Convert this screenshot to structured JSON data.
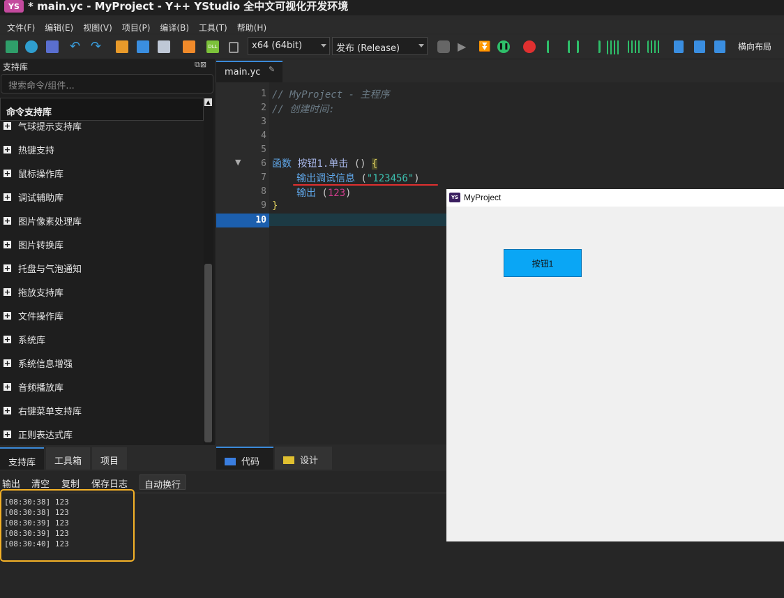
{
  "window": {
    "app_logo": "YS",
    "title": "* main.yc - MyProject - Y++ YStudio 全中文可视化开发环境"
  },
  "menu": [
    "文件(F)",
    "编辑(E)",
    "视图(V)",
    "项目(P)",
    "编译(B)",
    "工具(T)",
    "帮助(H)"
  ],
  "toolbar": {
    "platform": "x64 (64bit)",
    "config": "发布 (Release)",
    "layout_label": "横向布局",
    "icons": [
      "layers-icon",
      "app-icon",
      "save-icon",
      "undo-icon",
      "redo-icon",
      "cut-icon",
      "copy-icon",
      "paste-icon",
      "search-icon",
      "dll-icon",
      "delete-icon",
      "compile-icon",
      "run-icon",
      "step-icon",
      "pause-icon",
      "stop-icon",
      "align-left-icon",
      "align-center-icon",
      "align-right-icon",
      "distribute-h-icon",
      "distribute-v-icon",
      "spread-icon",
      "layout-icon-1",
      "layout-icon-2",
      "layout-icon-3"
    ],
    "accent": "#2fbf6a"
  },
  "left_panel": {
    "title": "支持库",
    "search_placeholder": "搜索命令/组件...",
    "header": "命令支持库",
    "items": [
      "气球提示支持库",
      "热键支持",
      "鼠标操作库",
      "调试辅助库",
      "图片像素处理库",
      "图片转换库",
      "托盘与气泡通知",
      "拖放支持库",
      "文件操作库",
      "系统库",
      "系统信息增强",
      "音频播放库",
      "右键菜单支持库",
      "正则表达式库"
    ],
    "expander": "+",
    "tabs": [
      "支持库",
      "工具箱",
      "项目"
    ]
  },
  "editor": {
    "file_tab": "main.yc",
    "line_numbers": [
      "1",
      "2",
      "3",
      "4",
      "5",
      "6",
      "7",
      "8",
      "9",
      "10"
    ],
    "current_line": "10",
    "code": {
      "l1": "// MyProject - 主程序",
      "l2": "// 创建时间:",
      "l6_kw": "函数",
      "l6_name": "按钮1",
      "l6_dot": ".",
      "l6_event": "单击",
      "l6_paren": " () ",
      "l6_brace": "{",
      "l7_fn": "输出调试信息",
      "l7_open": " (",
      "l7_str": "\"123456\"",
      "l7_close": ")",
      "l8_fn": "输出",
      "l8_open": " (",
      "l8_num": "123",
      "l8_close": ")",
      "l9": "}"
    },
    "bottom_tabs": [
      "代码",
      "设计"
    ]
  },
  "output": {
    "label": "输出",
    "buttons": [
      "清空",
      "复制",
      "保存日志",
      "自动换行"
    ],
    "lines": [
      "[08:30:38] 123",
      "[08:30:38] 123",
      "[08:30:39] 123",
      "[08:30:39] 123",
      "[08:30:40] 123"
    ],
    "highlight_color": "#f5b227"
  },
  "app_window": {
    "logo": "YS",
    "title": "MyProject",
    "button_label": "按钮1",
    "button_color": "#0aa6f5"
  }
}
